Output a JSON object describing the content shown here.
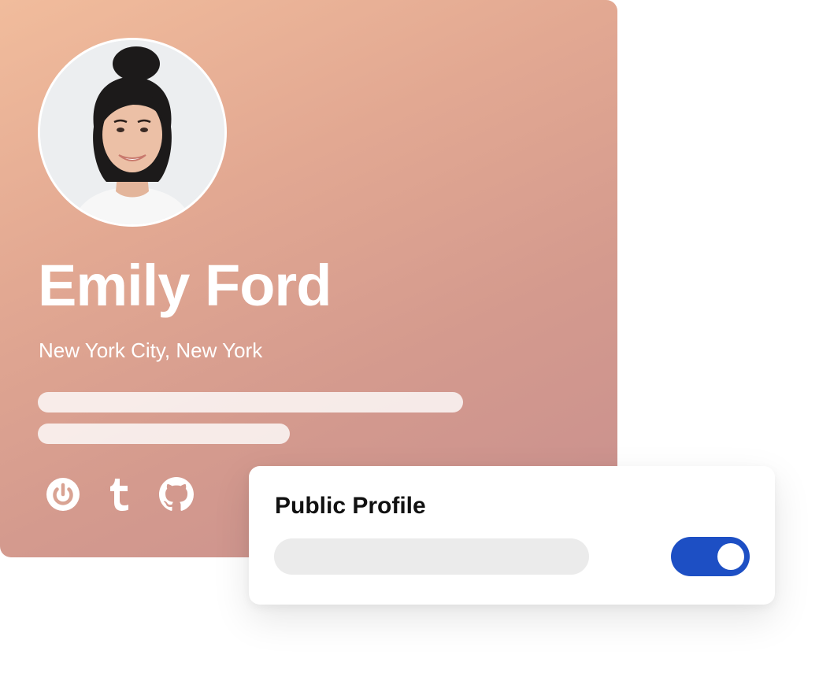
{
  "profile": {
    "name": "Emily Ford",
    "location": "New York City, New York",
    "social_icons": [
      "power-icon",
      "tumblr-icon",
      "github-icon"
    ]
  },
  "settings": {
    "title": "Public Profile",
    "toggle_on": true,
    "toggle_color": "#1d4fc4"
  },
  "colors": {
    "card_gradient_start": "#f1bc9c",
    "card_gradient_end": "#c88f8e"
  }
}
